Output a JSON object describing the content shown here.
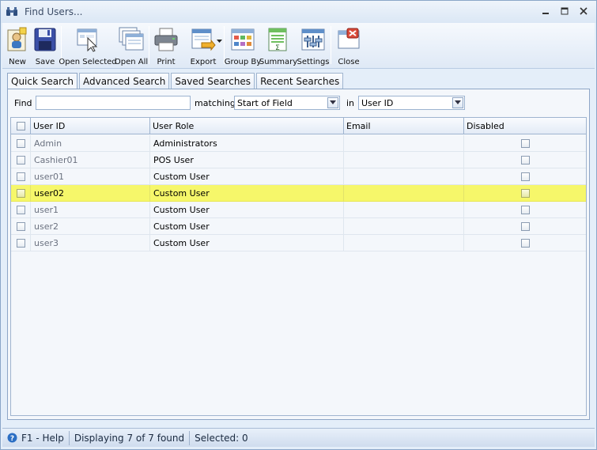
{
  "window": {
    "title": "Find Users..."
  },
  "toolbar": {
    "buttons": [
      {
        "label": "New",
        "icon": "new-user-icon"
      },
      {
        "label": "Save",
        "icon": "floppy-disk-icon"
      },
      {
        "label": "Open Selected",
        "icon": "open-selected-icon"
      },
      {
        "label": "Open All",
        "icon": "open-all-icon"
      },
      {
        "label": "Print",
        "icon": "printer-icon"
      },
      {
        "label": "Export",
        "icon": "export-icon"
      },
      {
        "label": "Group By",
        "icon": "group-by-icon"
      },
      {
        "label": "Summary",
        "icon": "summary-icon"
      },
      {
        "label": "Settings",
        "icon": "settings-icon"
      },
      {
        "label": "Close",
        "icon": "close-window-icon"
      }
    ]
  },
  "tabs": [
    "Quick Search",
    "Advanced Search",
    "Saved Searches",
    "Recent Searches"
  ],
  "search": {
    "find_label": "Find",
    "find_value": "",
    "matching_label": "matching",
    "matching_value": "Start of Field",
    "in_label": "in",
    "in_value": "User ID"
  },
  "grid": {
    "columns": [
      "User ID",
      "User Role",
      "Email",
      "Disabled"
    ],
    "rows": [
      {
        "user_id": "Admin",
        "role": "Administrators",
        "email": "",
        "disabled": false
      },
      {
        "user_id": "Cashier01",
        "role": "POS User",
        "email": "",
        "disabled": false
      },
      {
        "user_id": "user01",
        "role": "Custom User",
        "email": "",
        "disabled": false
      },
      {
        "user_id": "user02",
        "role": "Custom User",
        "email": "",
        "disabled": false
      },
      {
        "user_id": "user1",
        "role": "Custom User",
        "email": "",
        "disabled": false
      },
      {
        "user_id": "user2",
        "role": "Custom User",
        "email": "",
        "disabled": false
      },
      {
        "user_id": "user3",
        "role": "Custom User",
        "email": "",
        "disabled": false
      }
    ],
    "selected_row_color": "#f6f76a"
  },
  "status": {
    "help": "F1 - Help",
    "displaying": "Displaying 7 of 7 found",
    "selected": "Selected: 0"
  }
}
